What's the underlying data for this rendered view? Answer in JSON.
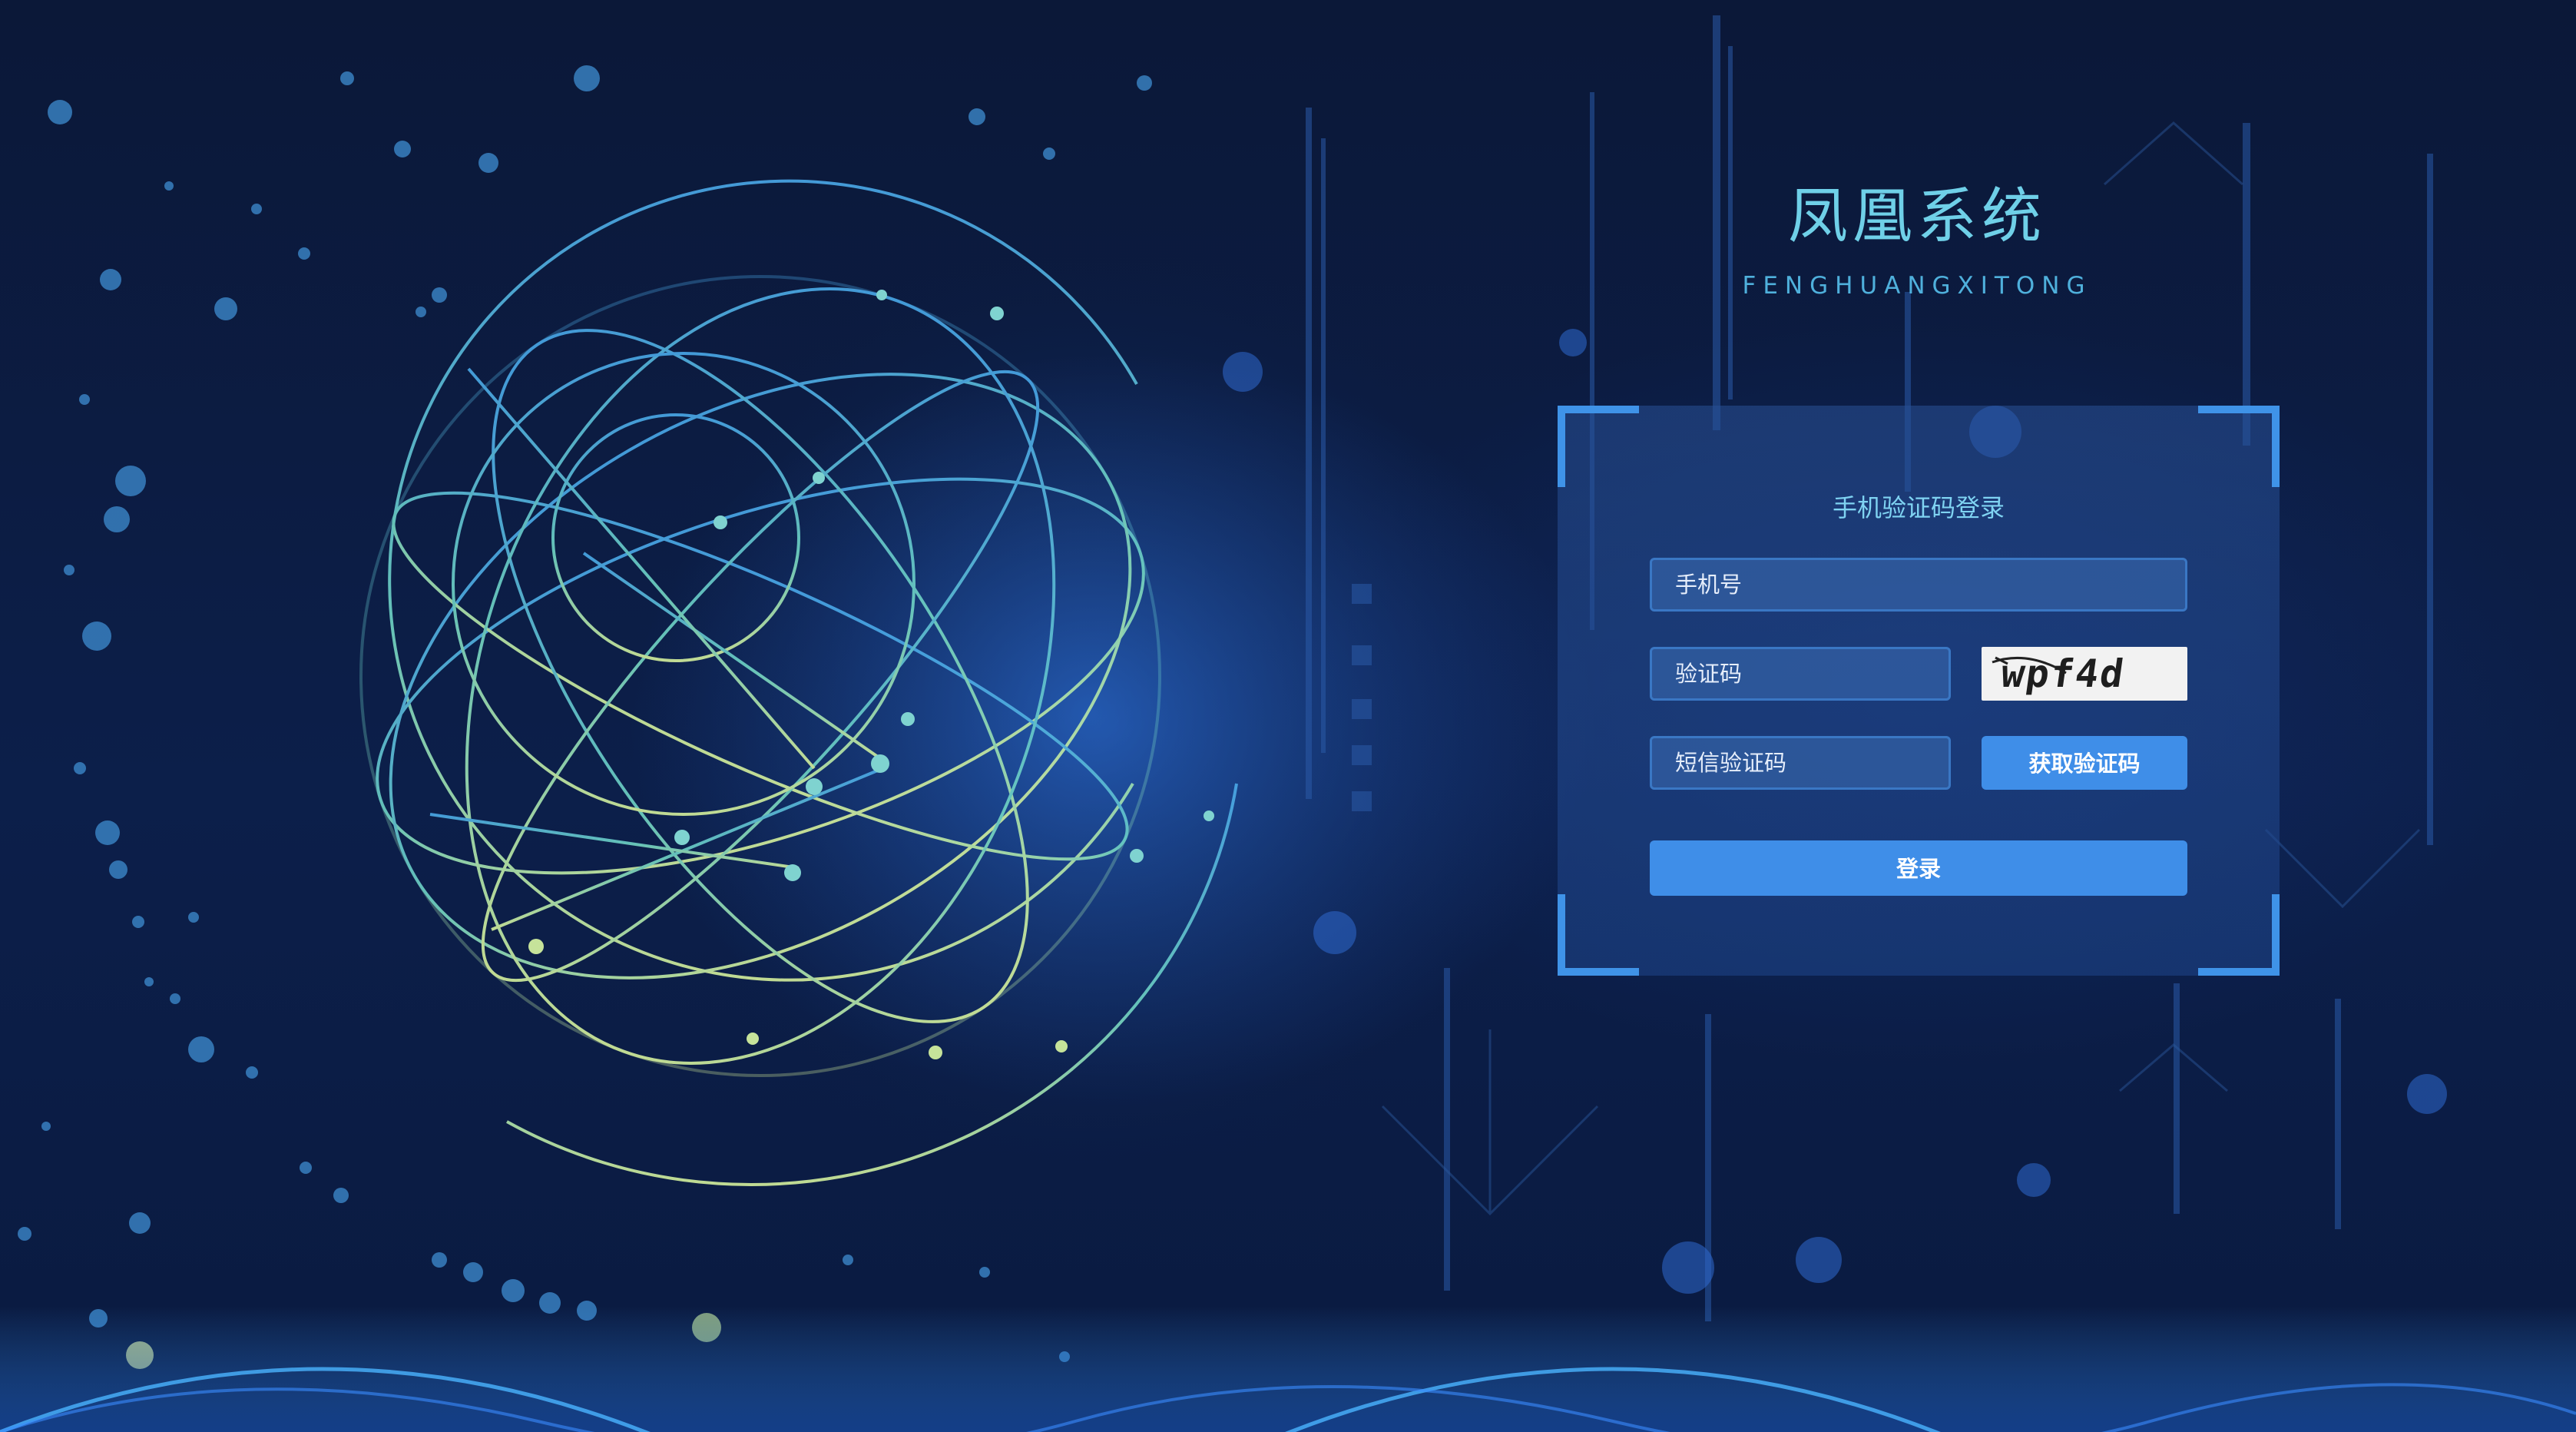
{
  "app": {
    "title": "凤凰系统",
    "subtitle": "FENGHUANGXITONG"
  },
  "login": {
    "heading": "手机验证码登录",
    "phone_placeholder": "手机号",
    "captcha_placeholder": "验证码",
    "captcha_text": "wpf4d",
    "sms_placeholder": "短信验证码",
    "get_code_label": "获取验证码",
    "submit_label": "登录"
  },
  "colors": {
    "accent": "#3f8ee8",
    "title": "#6fd0e8",
    "background": "#0b1c44"
  }
}
